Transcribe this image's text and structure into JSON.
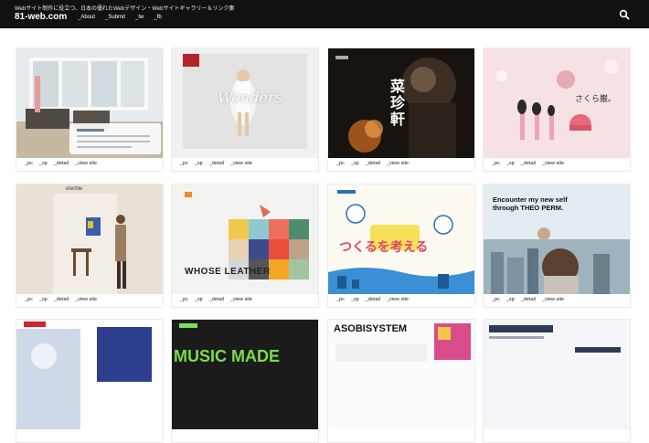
{
  "header": {
    "tagline": "Webサイト制作に役立つ、日本の優れたWebデザイン・Webサイトギャラリー＆リンク集",
    "logo": "81-web.com",
    "nav": [
      "_About",
      "_Submit",
      "_tw",
      "_fb"
    ]
  },
  "card_links": [
    "_pc",
    "_sp",
    "_detail",
    "_view site"
  ],
  "cards": [
    {
      "thumb_text": ""
    },
    {
      "thumb_text": "Wonders"
    },
    {
      "thumb_text": "菜珍軒"
    },
    {
      "thumb_text": "さくら巌。"
    },
    {
      "thumb_text": "eterble"
    },
    {
      "thumb_text": "WHOSE LEATHER"
    },
    {
      "thumb_text": "つくるを考える"
    },
    {
      "thumb_text": "Encounter my new self through THEO PERM."
    },
    {
      "thumb_text": ""
    },
    {
      "thumb_text": "MUSIC MADE"
    },
    {
      "thumb_text": "ASOBISYSTEM"
    },
    {
      "thumb_text": ""
    }
  ],
  "colors": {
    "header_bg": "#111111",
    "accent_pink": "#f7e3e5",
    "accent_blue": "#2f4a95"
  }
}
